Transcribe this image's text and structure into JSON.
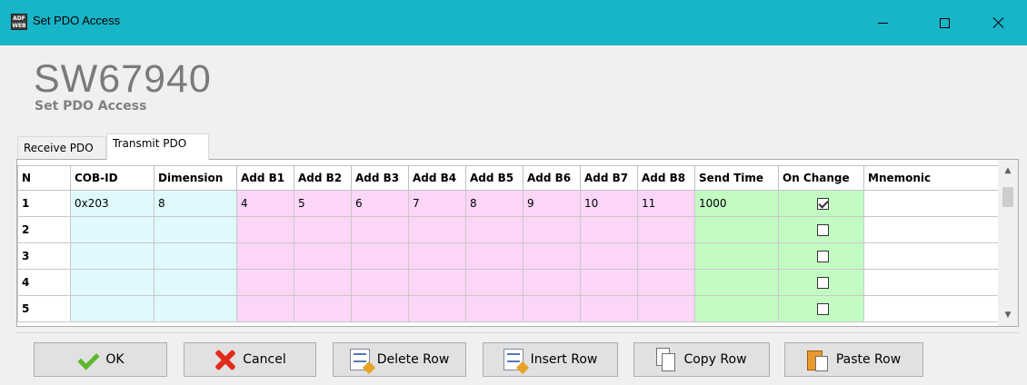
{
  "window": {
    "title": "Set PDO Access",
    "icon_text_top": "ADF",
    "icon_text_bottom": "WEB"
  },
  "header": {
    "product_code": "SW67940",
    "subtitle": "Set PDO Access"
  },
  "tabs": [
    {
      "label": "Receive PDO",
      "selected": false
    },
    {
      "label": "Transmit PDO",
      "selected": true
    }
  ],
  "grid": {
    "columns": [
      "N",
      "COB-ID",
      "Dimension",
      "Add B1",
      "Add B2",
      "Add B3",
      "Add B4",
      "Add B5",
      "Add B6",
      "Add B7",
      "Add B8",
      "Send Time",
      "On Change",
      "Mnemonic"
    ],
    "rows": [
      {
        "n": "1",
        "cob_id": "0x203",
        "dimension": "8",
        "b1": "4",
        "b2": "5",
        "b3": "6",
        "b4": "7",
        "b5": "8",
        "b6": "9",
        "b7": "10",
        "b8": "11",
        "send_time": "1000",
        "on_change": true,
        "mnemonic": ""
      },
      {
        "n": "2",
        "cob_id": "",
        "dimension": "",
        "b1": "",
        "b2": "",
        "b3": "",
        "b4": "",
        "b5": "",
        "b6": "",
        "b7": "",
        "b8": "",
        "send_time": "",
        "on_change": false,
        "mnemonic": ""
      },
      {
        "n": "3",
        "cob_id": "",
        "dimension": "",
        "b1": "",
        "b2": "",
        "b3": "",
        "b4": "",
        "b5": "",
        "b6": "",
        "b7": "",
        "b8": "",
        "send_time": "",
        "on_change": false,
        "mnemonic": ""
      },
      {
        "n": "4",
        "cob_id": "",
        "dimension": "",
        "b1": "",
        "b2": "",
        "b3": "",
        "b4": "",
        "b5": "",
        "b6": "",
        "b7": "",
        "b8": "",
        "send_time": "",
        "on_change": false,
        "mnemonic": ""
      },
      {
        "n": "5",
        "cob_id": "",
        "dimension": "",
        "b1": "",
        "b2": "",
        "b3": "",
        "b4": "",
        "b5": "",
        "b6": "",
        "b7": "",
        "b8": "",
        "send_time": "",
        "on_change": false,
        "mnemonic": ""
      }
    ],
    "colors": {
      "cob_dimension": "#dff9fd",
      "address_bytes": "#fbd6f7",
      "send_time_on_change": "#c3fcc3"
    }
  },
  "buttons": {
    "ok": "OK",
    "cancel": "Cancel",
    "delete_row": "Delete Row",
    "insert_row": "Insert Row",
    "copy_row": "Copy Row",
    "paste_row": "Paste Row"
  },
  "colors": {
    "titlebar": "#18b4c8",
    "product_code": "#7a7a7a"
  },
  "icons": [
    "app-icon",
    "minimize-icon",
    "maximize-icon",
    "close-icon",
    "checkmark-icon",
    "cancel-x-icon",
    "delete-row-icon",
    "insert-row-icon",
    "copy-row-icon",
    "paste-row-icon",
    "scroll-up-icon",
    "scroll-down-icon"
  ]
}
